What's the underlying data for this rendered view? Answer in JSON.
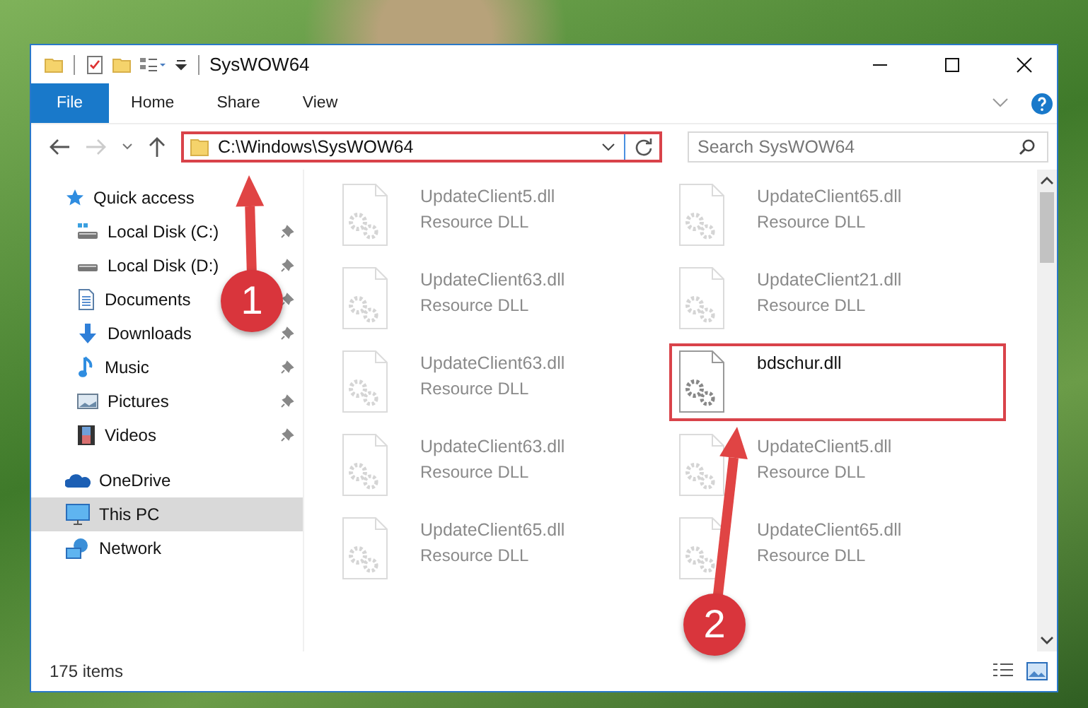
{
  "window": {
    "title": "SysWOW64"
  },
  "ribbon": {
    "tabs": [
      {
        "label": "File",
        "selected": true
      },
      {
        "label": "Home",
        "selected": false
      },
      {
        "label": "Share",
        "selected": false
      },
      {
        "label": "View",
        "selected": false
      }
    ]
  },
  "address_bar": {
    "path": "C:\\Windows\\SysWOW64",
    "highlighted": true
  },
  "search": {
    "placeholder": "Search SysWOW64"
  },
  "sidebar": {
    "items": [
      {
        "label": "Quick access",
        "kind": "star",
        "selected": false,
        "children": [
          {
            "label": "Local Disk (C:)",
            "kind": "systemdrive",
            "pinned": true
          },
          {
            "label": "Local Disk (D:)",
            "kind": "drive",
            "pinned": true
          },
          {
            "label": "Documents",
            "kind": "document",
            "pinned": true
          },
          {
            "label": "Downloads",
            "kind": "download",
            "pinned": true
          },
          {
            "label": "Music",
            "kind": "music",
            "pinned": true
          },
          {
            "label": "Pictures",
            "kind": "picture",
            "pinned": true
          },
          {
            "label": "Videos",
            "kind": "film",
            "pinned": true
          }
        ]
      },
      {
        "label": "OneDrive",
        "kind": "cloud",
        "selected": false
      },
      {
        "label": "This PC",
        "kind": "monitor",
        "selected": true
      },
      {
        "label": "Network",
        "kind": "network",
        "selected": false
      }
    ]
  },
  "files": [
    {
      "name": "UpdateClient5.dll",
      "type": "Resource DLL",
      "dimmed": true,
      "highlighted": false
    },
    {
      "name": "UpdateClient65.dll",
      "type": "Resource DLL",
      "dimmed": true,
      "highlighted": false
    },
    {
      "name": "UpdateClient63.dll",
      "type": "Resource DLL",
      "dimmed": true,
      "highlighted": false
    },
    {
      "name": "UpdateClient21.dll",
      "type": "Resource DLL",
      "dimmed": true,
      "highlighted": false
    },
    {
      "name": "UpdateClient63.dll",
      "type": "Resource DLL",
      "dimmed": true,
      "highlighted": false
    },
    {
      "name": "bdschur.dll",
      "dimmed": false,
      "highlighted": true
    },
    {
      "name": "UpdateClient63.dll",
      "type": "Resource DLL",
      "dimmed": true,
      "highlighted": false
    },
    {
      "name": "UpdateClient5.dll",
      "type": "Resource DLL",
      "dimmed": true,
      "highlighted": false
    },
    {
      "name": "UpdateClient65.dll",
      "type": "Resource DLL",
      "dimmed": true,
      "highlighted": false
    },
    {
      "name": "UpdateClient65.dll",
      "type": "Resource DLL",
      "dimmed": true,
      "highlighted": false
    }
  ],
  "status_bar": {
    "item_count": "175 items"
  },
  "annotations": [
    {
      "number": "1"
    },
    {
      "number": "2"
    }
  ]
}
